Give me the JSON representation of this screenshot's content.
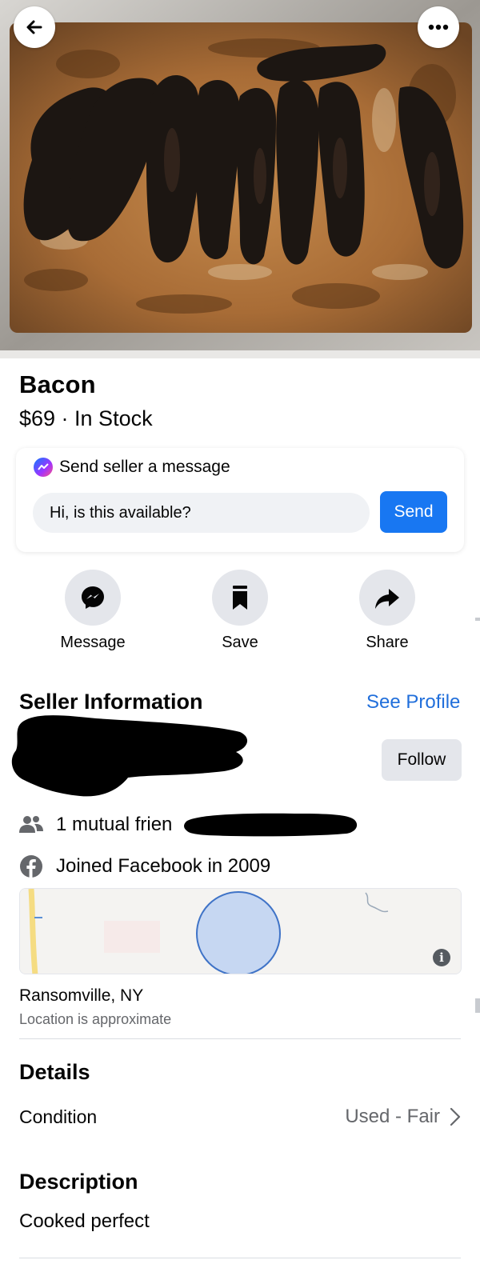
{
  "listing": {
    "title": "Bacon",
    "price_line": "$69 · In Stock"
  },
  "message_box": {
    "header": "Send seller a message",
    "input_value": "Hi, is this available?",
    "send_label": "Send"
  },
  "actions": [
    {
      "label": "Message",
      "icon": "messenger-icon"
    },
    {
      "label": "Save",
      "icon": "bookmark-icon"
    },
    {
      "label": "Share",
      "icon": "share-arrow-icon"
    }
  ],
  "seller": {
    "section_title": "Seller Information",
    "see_profile": "See Profile",
    "follow_label": "Follow",
    "mutual_friends": "1 mutual frien",
    "joined": "Joined Facebook in 2009"
  },
  "location": {
    "city": "Ransomville, NY",
    "note": "Location is approximate"
  },
  "details": {
    "section_title": "Details",
    "condition_label": "Condition",
    "condition_value": "Used - Fair"
  },
  "description": {
    "section_title": "Description",
    "text": "Cooked perfect"
  },
  "colors": {
    "accent": "#1877f2",
    "link": "#216fdb",
    "secondary_text": "#65676b",
    "button_gray": "#e4e6eb"
  }
}
